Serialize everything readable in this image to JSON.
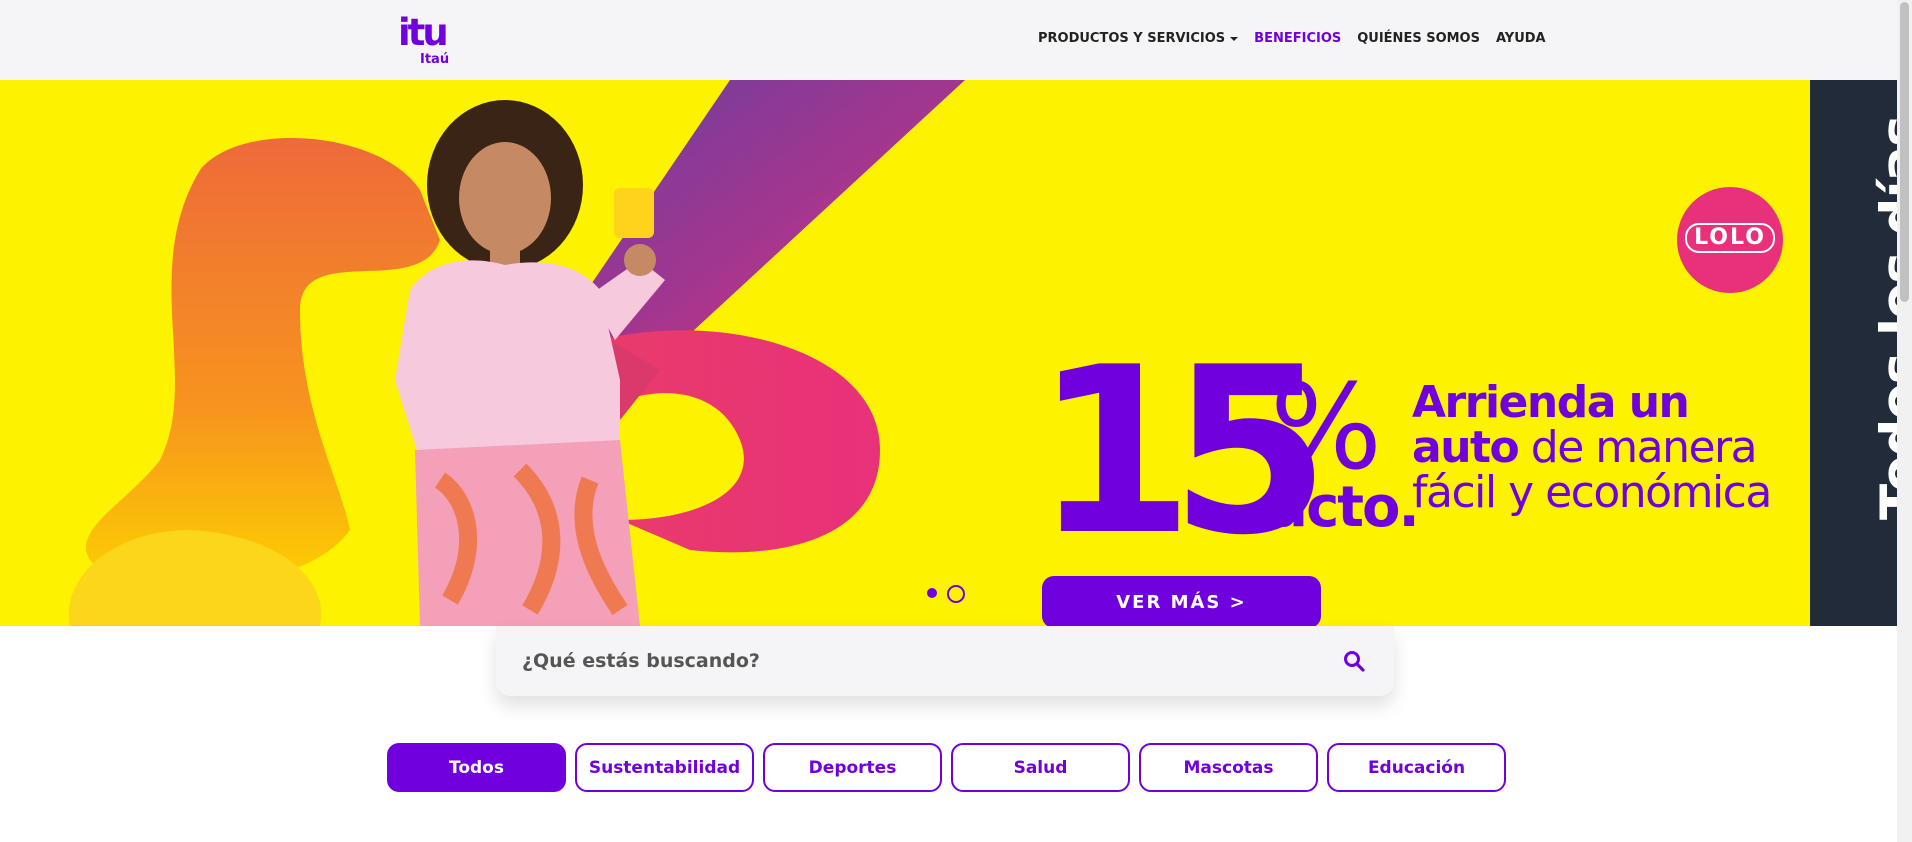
{
  "header": {
    "logo_main": "itu",
    "logo_sub": "Itaú",
    "nav": [
      {
        "label": "PRODUCTOS Y SERVICIOS",
        "has_dropdown": true,
        "active": false
      },
      {
        "label": "BENEFICIOS",
        "has_dropdown": false,
        "active": true
      },
      {
        "label": "QUIÉNES SOMOS",
        "has_dropdown": false,
        "active": false
      },
      {
        "label": "AYUDA",
        "has_dropdown": false,
        "active": false
      }
    ]
  },
  "banner": {
    "partner_logo": "LOLO",
    "discount_number": "15",
    "discount_symbol": "%",
    "discount_suffix": "dcto.",
    "promo_bold_1": "Arrienda un",
    "promo_bold_2": "auto",
    "promo_rest_2": " de manera",
    "promo_line_3": "fácil y económica",
    "cta_label": "VER MÁS  >",
    "side_label": "Todos los días",
    "carousel": {
      "total": 2,
      "active_index": 1
    }
  },
  "search": {
    "placeholder": "¿Qué estás buscando?"
  },
  "filters": [
    {
      "label": "Todos",
      "active": true
    },
    {
      "label": "Sustentabilidad",
      "active": false
    },
    {
      "label": "Deportes",
      "active": false
    },
    {
      "label": "Salud",
      "active": false
    },
    {
      "label": "Mascotas",
      "active": false
    },
    {
      "label": "Educación",
      "active": false
    }
  ],
  "colors": {
    "brand_purple": "#7000de",
    "banner_yellow": "#fdf200",
    "side_strip": "#222b3a",
    "lolo_pink": "#e8317a"
  },
  "icons": {
    "search": "search-icon",
    "caret": "chevron-down-icon"
  }
}
